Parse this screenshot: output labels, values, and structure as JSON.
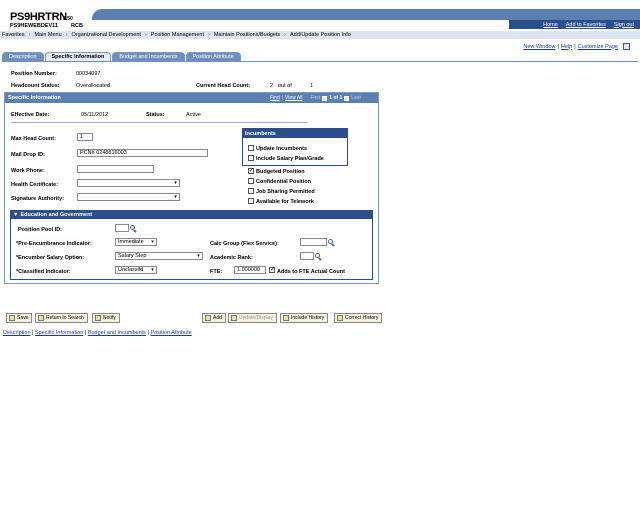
{
  "header": {
    "app_name": "PS9HRTRN",
    "app_version": "8.50",
    "database": "PS9HEWEBDEV11",
    "node": "RCB",
    "links": [
      "Home",
      "Add to Favorites",
      "Sign out"
    ]
  },
  "breadcrumbs": [
    "Favorites",
    "Main Menu",
    "Organizational Development",
    "Position Management",
    "Maintain Positions/Budgets",
    "Add/Update Position Info"
  ],
  "top_links": {
    "new_window": "New Window",
    "help": "Help",
    "customize": "Customize Page"
  },
  "tabs": [
    {
      "label": "Description",
      "active": false
    },
    {
      "label": "Specific Information",
      "active": true
    },
    {
      "label": "Budget and Incumbents",
      "active": false
    },
    {
      "label": "Position Attribute",
      "active": false
    }
  ],
  "summary": {
    "position_number_label": "Position Number:",
    "position_number": "00034097",
    "headcount_status_label": "Headcount Status:",
    "headcount_status": "Overallocated",
    "current_head_count_label": "Current Head Count:",
    "current_head_count": "2",
    "out_of_label": "out of",
    "out_of_value": "1"
  },
  "panel": {
    "title": "Specific Information",
    "nav_find": "Find",
    "nav_view_all": "View All",
    "nav_first": "First",
    "nav_range": "1 of 1",
    "nav_last": "Last",
    "effective_date_label": "Effective Date:",
    "effective_date": "05/11/2012",
    "status_label": "Status:",
    "status": "Active",
    "max_head_count_label": "Max Head Count:",
    "max_head_count": "1",
    "mail_drop_label": "Mail Drop ID:",
    "mail_drop": "PCN# 0248816003",
    "work_phone_label": "Work Phone:",
    "work_phone": "",
    "health_cert_label": "Health Certificate:",
    "health_cert": "",
    "signature_label": "Signature Authority:",
    "signature": ""
  },
  "incumbents": {
    "title": "Incumbents",
    "update_incumbents": {
      "label": "Update Incumbents",
      "checked": false
    },
    "include_salary": {
      "label": "Include Salary Plan/Grade",
      "checked": false
    }
  },
  "flags": [
    {
      "label": "Budgeted Position",
      "checked": true
    },
    {
      "label": "Confidential Position",
      "checked": false
    },
    {
      "label": "Job Sharing Permitted",
      "checked": false
    },
    {
      "label": "Available for Telework",
      "checked": false
    }
  ],
  "education": {
    "title": "Education and Government",
    "position_pool_label": "Position Pool ID:",
    "position_pool": "",
    "pre_enc_label": "*Pre-Encumbrance Indicator:",
    "pre_enc": "Immediate",
    "calc_group_label": "Calc Group (Flex Service):",
    "calc_group": "",
    "encumber_salary_label": "*Encumber Salary Option:",
    "encumber_salary": "Salary Step",
    "academic_rank_label": "Academic Rank:",
    "academic_rank": "",
    "classified_label": "*Classified Indicator:",
    "classified": "Unclassifd",
    "fte_label": "FTE:",
    "fte": "1.000000",
    "adds_to_fte_label": "Adds to FTE Actual Count",
    "adds_to_fte_checked": true
  },
  "buttons": {
    "save": "Save",
    "return_to_search": "Return to Search",
    "notify": "Notify",
    "add": "Add",
    "update_display": "Update/Display",
    "include_history": "Include History",
    "correct_history": "Correct History"
  },
  "footer_links": [
    "Description",
    "Specific Information",
    "Budget and Incumbents",
    "Position Attribute"
  ]
}
